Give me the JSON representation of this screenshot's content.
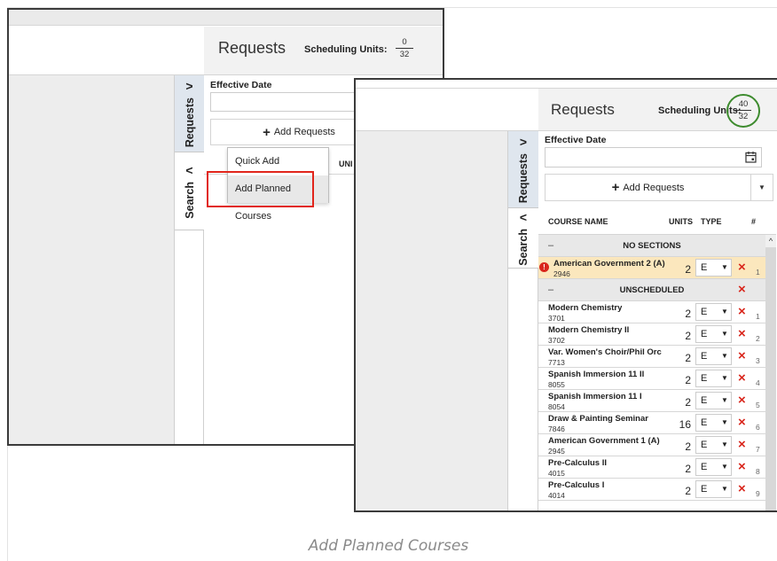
{
  "caption": "Add Planned Courses",
  "back_window": {
    "tabs": {
      "requests": {
        "label": "Requests",
        "chevron": ">"
      },
      "search": {
        "label": "Search",
        "chevron": "<"
      }
    },
    "panel_title": "Requests",
    "scheduling_units": {
      "label": "Scheduling Units:",
      "numerator": "0",
      "denominator": "32"
    },
    "effective_date_label": "Effective Date",
    "add_requests_label": "Add Requests",
    "units_fragment": "UNI",
    "dropdown": {
      "items": [
        "Quick Add",
        "Add Planned Courses"
      ]
    },
    "highlight_color": "#e1251b"
  },
  "front_window": {
    "tabs": {
      "requests": {
        "label": "Requests",
        "chevron": ">"
      },
      "search": {
        "label": "Search",
        "chevron": "<"
      }
    },
    "panel_title": "Requests",
    "scheduling_units": {
      "label": "Scheduling Units:",
      "numerator": "40",
      "denominator": "32"
    },
    "circle_color": "#3d8b2e",
    "effective_date_label": "Effective Date",
    "add_requests_label": "Add Requests",
    "columns": {
      "name": "COURSE NAME",
      "units": "UNITS",
      "type": "TYPE",
      "index": "#"
    },
    "groups": {
      "no_sections": {
        "dash": "–",
        "title": "NO SECTIONS"
      },
      "unscheduled": {
        "dash": "–",
        "title": "UNSCHEDULED"
      }
    },
    "warning_course": {
      "name": "American Government 2 (A)",
      "code": "2946",
      "units": "2",
      "type": "E",
      "index": "1"
    },
    "courses": [
      {
        "name": "Modern Chemistry",
        "code": "3701",
        "units": "2",
        "type": "E",
        "index": "1"
      },
      {
        "name": "Modern Chemistry II",
        "code": "3702",
        "units": "2",
        "type": "E",
        "index": "2"
      },
      {
        "name": "Var. Women's Choir/Phil Orch I",
        "code": "7713",
        "units": "2",
        "type": "E",
        "index": "3"
      },
      {
        "name": "Spanish Immersion 11 II",
        "code": "8055",
        "units": "2",
        "type": "E",
        "index": "4"
      },
      {
        "name": "Spanish Immersion 11 I",
        "code": "8054",
        "units": "2",
        "type": "E",
        "index": "5"
      },
      {
        "name": "Draw & Painting Seminar",
        "code": "7846",
        "units": "16",
        "type": "E",
        "index": "6"
      },
      {
        "name": "American Government 1 (A)",
        "code": "2945",
        "units": "2",
        "type": "E",
        "index": "7"
      },
      {
        "name": "Pre-Calculus II",
        "code": "4015",
        "units": "2",
        "type": "E",
        "index": "8"
      },
      {
        "name": "Pre-Calculus I",
        "code": "4014",
        "units": "2",
        "type": "E",
        "index": "9"
      }
    ],
    "icons": {
      "delete": "×",
      "caret": "▼",
      "scroll_up": "^"
    }
  }
}
